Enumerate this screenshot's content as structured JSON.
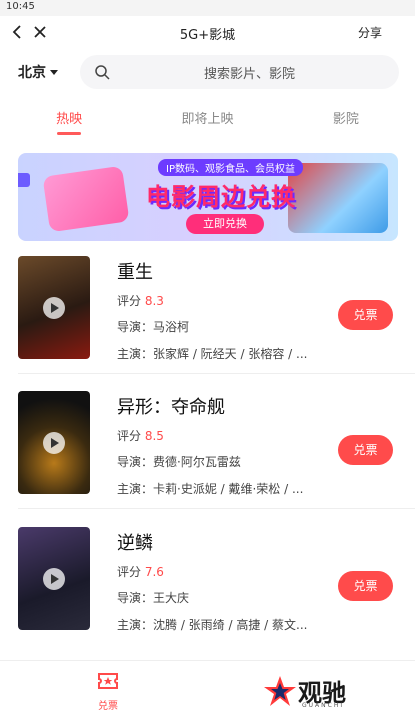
{
  "status": {
    "time": "10:45"
  },
  "nav": {
    "title": "5G+影城",
    "share_label": "分享"
  },
  "search": {
    "city": "北京",
    "placeholder": "搜索影片、影院"
  },
  "tabs": [
    {
      "label": "热映",
      "active": true
    },
    {
      "label": "即将上映",
      "active": false
    },
    {
      "label": "影院",
      "active": false
    }
  ],
  "banner": {
    "subtitle": "IP数码、观影食品、会员权益",
    "title": "电影周边兑换",
    "button": "立即兑换"
  },
  "movies": [
    {
      "title": "重生",
      "score_label": "评分",
      "score": "8.3",
      "director": "导演：马浴柯",
      "cast": "主演：张家辉 / 阮经天 / 张榕容 / ...",
      "button": "兑票"
    },
    {
      "title": "异形：夺命舰",
      "score_label": "评分",
      "score": "8.5",
      "director": "导演：费德·阿尔瓦雷兹",
      "cast": "主演：卡莉·史派妮 / 戴维·荣松 / ...",
      "button": "兑票"
    },
    {
      "title": "逆鳞",
      "score_label": "评分",
      "score": "7.6",
      "director": "导演：王大庆",
      "cast": "主演：沈腾 / 张雨绮 / 高捷 / 蔡文...",
      "button": "兑票"
    }
  ],
  "bottom": {
    "redeem_label": "兑票",
    "logo_cn": "观驰",
    "logo_en": "GUANCHI"
  },
  "colors": {
    "accent": "#ff4b4b",
    "score": "#ff4a4a"
  }
}
